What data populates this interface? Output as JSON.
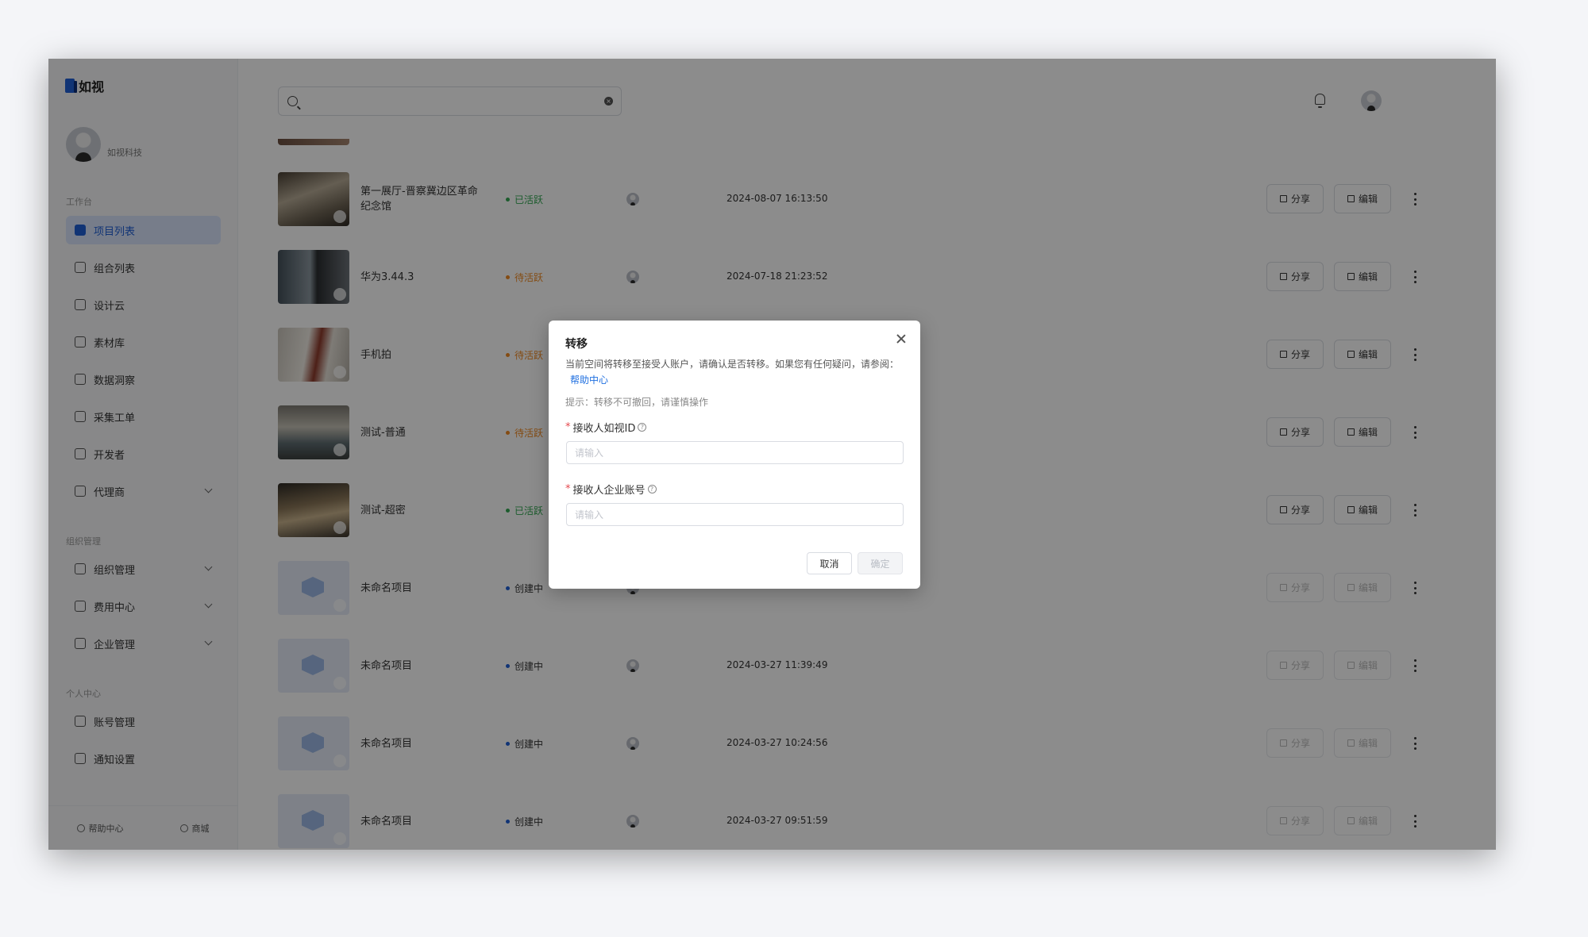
{
  "brand": {
    "name": "如视"
  },
  "profile": {
    "org": "如视科技"
  },
  "sidebar": {
    "sections": [
      {
        "title": "工作台",
        "items": [
          {
            "label": "项目列表",
            "active": true,
            "icon": "project-list-icon"
          },
          {
            "label": "组合列表",
            "icon": "layers-icon"
          },
          {
            "label": "设计云",
            "icon": "monitor-icon"
          },
          {
            "label": "素材库",
            "icon": "folder-icon"
          },
          {
            "label": "数据洞察",
            "icon": "chart-icon"
          },
          {
            "label": "采集工单",
            "icon": "document-icon"
          },
          {
            "label": "开发者",
            "icon": "code-icon"
          },
          {
            "label": "代理商",
            "icon": "briefcase-icon",
            "expandable": true
          }
        ]
      },
      {
        "title": "组织管理",
        "items": [
          {
            "label": "组织管理",
            "icon": "org-icon",
            "expandable": true
          },
          {
            "label": "费用中心",
            "icon": "wallet-icon",
            "expandable": true
          },
          {
            "label": "企业管理",
            "icon": "shield-icon",
            "expandable": true
          }
        ]
      },
      {
        "title": "个人中心",
        "items": [
          {
            "label": "账号管理",
            "icon": "user-icon"
          },
          {
            "label": "通知设置",
            "icon": "bell-icon"
          }
        ]
      }
    ],
    "footer": {
      "help": "帮助中心",
      "shop": "商城"
    }
  },
  "search": {
    "placeholder": ""
  },
  "actions": {
    "share": "分享",
    "edit": "编辑"
  },
  "projects": [
    {
      "name": "第一展厅-晋察冀边区革命纪念馆",
      "status": "已活跃",
      "status_type": "active",
      "time": "2024-08-07 16:13:50",
      "thumb": "photo1"
    },
    {
      "name": "华为3.44.3",
      "status": "待活跃",
      "status_type": "pending",
      "time": "2024-07-18 21:23:52",
      "thumb": "photo2"
    },
    {
      "name": "手机拍",
      "status": "待活跃",
      "status_type": "pending",
      "time": "",
      "thumb": "photo3"
    },
    {
      "name": "测试-普通",
      "status": "待活跃",
      "status_type": "pending",
      "time": "",
      "thumb": "photo4"
    },
    {
      "name": "测试-超密",
      "status": "已活跃",
      "status_type": "active",
      "time": "",
      "thumb": "photo5"
    },
    {
      "name": "未命名项目",
      "status": "创建中",
      "status_type": "creating",
      "time": "",
      "thumb": "placeholder"
    },
    {
      "name": "未命名项目",
      "status": "创建中",
      "status_type": "creating",
      "time": "2024-03-27 11:39:49",
      "thumb": "placeholder"
    },
    {
      "name": "未命名项目",
      "status": "创建中",
      "status_type": "creating",
      "time": "2024-03-27 10:24:56",
      "thumb": "placeholder"
    },
    {
      "name": "未命名项目",
      "status": "创建中",
      "status_type": "creating",
      "time": "2024-03-27 09:51:59",
      "thumb": "placeholder"
    }
  ],
  "modal": {
    "title": "转移",
    "description": "当前空间将转移至接受人账户，请确认是否转移。如果您有任何疑问，请参阅：",
    "help_link": "帮助中心",
    "tip": "提示：转移不可撤回，请谨慎操作",
    "field1": {
      "label": "接收人如视ID",
      "placeholder": "请输入",
      "value": ""
    },
    "field2": {
      "label": "接收人企业账号",
      "placeholder": "请输入",
      "value": ""
    },
    "cancel": "取消",
    "confirm": "确定"
  },
  "colors": {
    "accent": "#1f5fd6",
    "active": "#34a853",
    "pending": "#f08a24"
  }
}
